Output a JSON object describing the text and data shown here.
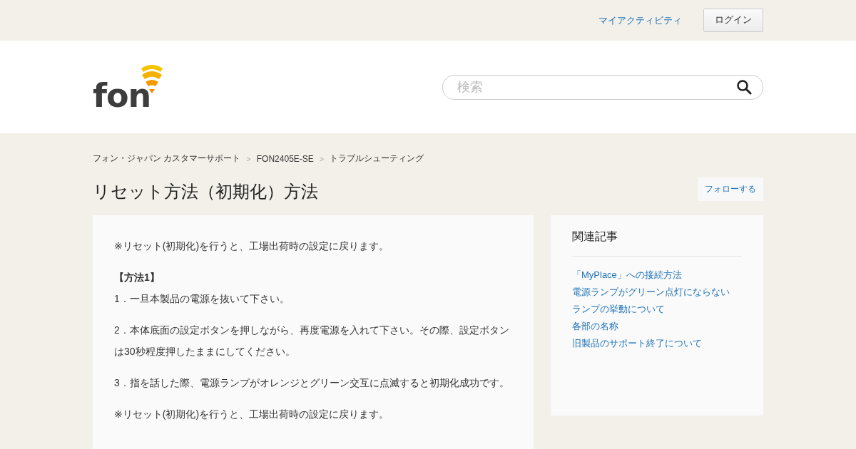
{
  "top_bar": {
    "my_activity_link": "マイアクティビティ",
    "login_button": "ログイン"
  },
  "header": {
    "logo_text": "fon",
    "search": {
      "placeholder": "検索"
    }
  },
  "breadcrumbs": [
    {
      "label": "フォン・ジャパン カスタマーサポート"
    },
    {
      "separator": ">",
      "label": "FON2405E-SE"
    },
    {
      "separator": ">",
      "label": "トラブルシューティング"
    }
  ],
  "article": {
    "title": "リセット方法（初期化）方法",
    "follow_button": "フォローする",
    "paragraphs": [
      {
        "kind": "text",
        "text": "※リセット(初期化)を行うと、工場出荷時の設定に戻ります。"
      },
      {
        "kind": "heading",
        "text": "【方法1】"
      },
      {
        "kind": "text",
        "text": "1．一旦本製品の電源を抜いて下さい。"
      },
      {
        "kind": "text",
        "text": "2．本体底面の設定ボタンを押しながら、再度電源を入れて下さい。その際、設定ボタンは30秒程度押したままにしてください。"
      },
      {
        "kind": "text",
        "text": "3．指を話した際、電源ランプがオレンジとグリーン交互に点滅すると初期化成功です。"
      },
      {
        "kind": "text",
        "text": "※リセット(初期化)を行うと、工場出荷時の設定に戻ります。"
      }
    ]
  },
  "related_articles": {
    "title": "関連記事",
    "links": [
      "「MyPlace」への接続方法",
      "電源ランプがグリーン点灯にならない",
      "ランプの挙動について",
      "各部の名称",
      "旧製品のサポート終了について"
    ]
  }
}
